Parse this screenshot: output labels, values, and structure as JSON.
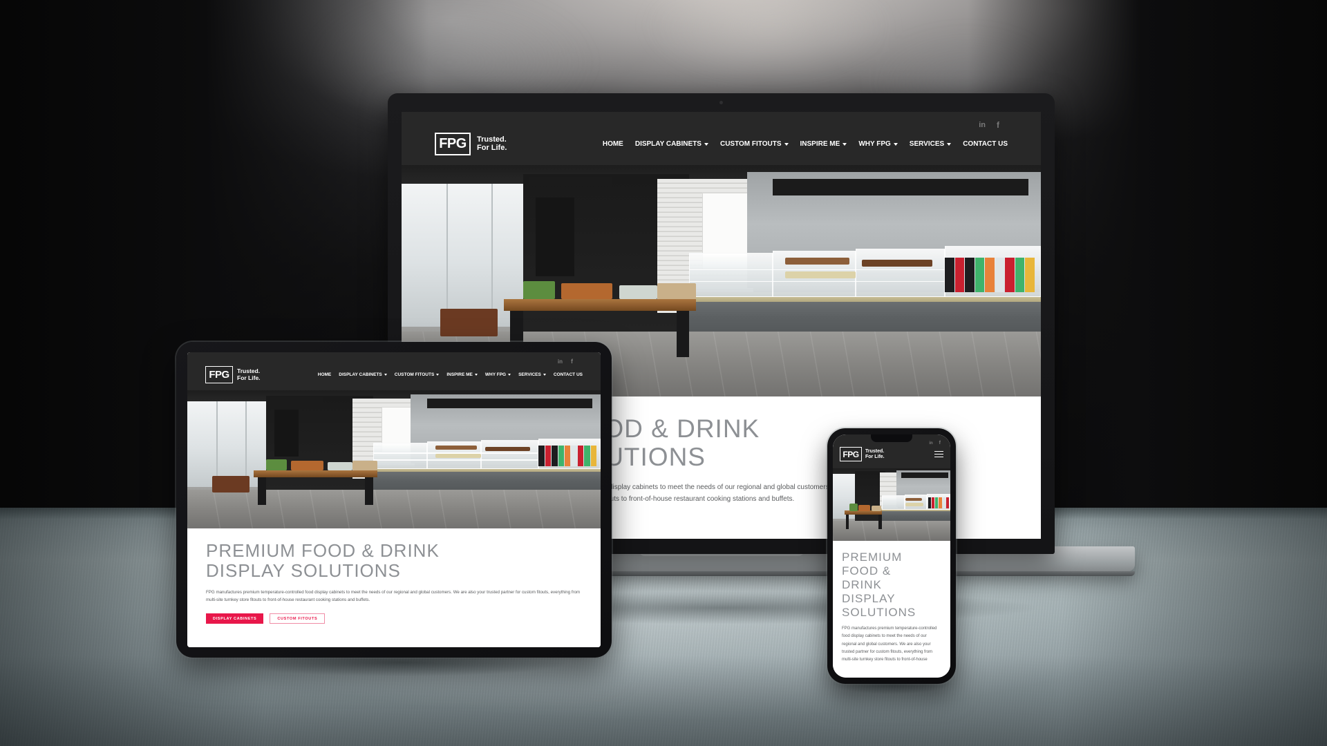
{
  "brand": {
    "logo_mark": "FPG",
    "tagline_line1": "Trusted.",
    "tagline_line2": "For Life.",
    "accent_color": "#e8174a",
    "nav_background": "#282828"
  },
  "social": {
    "linkedin": "in",
    "facebook": "f"
  },
  "nav": {
    "items": [
      {
        "label": "HOME",
        "has_dropdown": false
      },
      {
        "label": "DISPLAY CABINETS",
        "has_dropdown": true
      },
      {
        "label": "CUSTOM FITOUTS",
        "has_dropdown": true
      },
      {
        "label": "INSPIRE ME",
        "has_dropdown": true
      },
      {
        "label": "WHY FPG",
        "has_dropdown": true
      },
      {
        "label": "SERVICES",
        "has_dropdown": true
      },
      {
        "label": "CONTACT US",
        "has_dropdown": false
      }
    ]
  },
  "hero": {
    "heading_line1": "PREMIUM FOOD & DRINK",
    "heading_line2": "DISPLAY SOLUTIONS",
    "heading_mobile_lines": [
      "PREMIUM",
      "FOOD &",
      "DRINK",
      "DISPLAY",
      "SOLUTIONS"
    ],
    "body": "FPG manufactures premium temperature-controlled food display cabinets to meet the needs of our regional and global customers. We are also your trusted partner for custom fitouts, everything from multi-site turnkey store fitouts to front-of-house restaurant cooking stations and buffets.",
    "body_mobile": "FPG manufactures premium temperature-controlled food display cabinets to meet the needs of our regional and global customers. We are also your trusted partner for custom fitouts, everything from multi-site turnkey store fitouts to front-of-house",
    "cta_primary": "DISPLAY CABINETS",
    "cta_secondary": "CUSTOM FITOUTS",
    "image_alt": "Cafe interior with wooden produce display table and refrigerated food and drink display cabinets"
  },
  "mobile_menu": {
    "icon": "hamburger-menu"
  }
}
